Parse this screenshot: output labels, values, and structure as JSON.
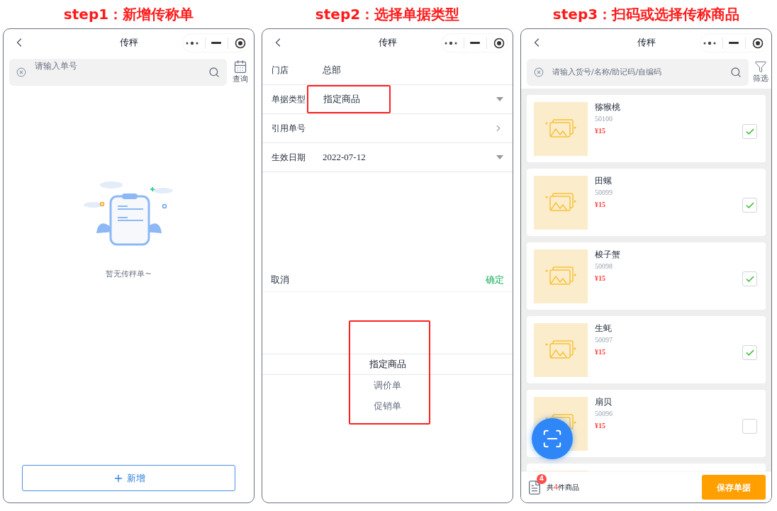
{
  "step1": {
    "heading": "step1：新增传称单",
    "nav_title": "传秤",
    "search": {
      "placeholder": "请输入单号"
    },
    "query_label": "查询",
    "empty_text": "暂无传秤单~",
    "add_button": "新增"
  },
  "step2": {
    "heading": "step2：选择单据类型",
    "nav_title": "传秤",
    "fields": [
      {
        "label": "门店",
        "value": "总部",
        "kind": "plain"
      },
      {
        "label": "单据类型",
        "value": "指定商品",
        "kind": "dropdown",
        "highlighted": true
      },
      {
        "label": "引用单号",
        "kind": "link"
      },
      {
        "label": "生效日期",
        "value": "2022-07-12",
        "kind": "dropdown"
      }
    ],
    "picker": {
      "cancel": "取消",
      "confirm": "确定",
      "highlighted": true,
      "options": [
        {
          "label": "指定商品",
          "selected": true
        },
        {
          "label": "调价单",
          "selected": false
        },
        {
          "label": "促销单",
          "selected": false
        }
      ]
    }
  },
  "step3": {
    "heading": "step3：扫码或选择传称商品",
    "nav_title": "传秤",
    "search": {
      "placeholder": "请输入货号/名称/助记码/自编码"
    },
    "filter_label": "筛选",
    "products": [
      {
        "name": "猕猴桃",
        "code": "50100",
        "price": "¥15",
        "checked": true
      },
      {
        "name": "田螺",
        "code": "50099",
        "price": "¥15",
        "checked": true
      },
      {
        "name": "梭子蟹",
        "code": "50098",
        "price": "¥15",
        "checked": true
      },
      {
        "name": "生蚝",
        "code": "50097",
        "price": "¥15",
        "checked": true
      },
      {
        "name": "扇贝",
        "code": "50096",
        "price": "¥15",
        "checked": false
      }
    ],
    "cart": {
      "badge": "4",
      "summary": {
        "prefix": "共",
        "count": "4",
        "suffix": "件商品"
      }
    },
    "save_button": "保存单据"
  }
}
